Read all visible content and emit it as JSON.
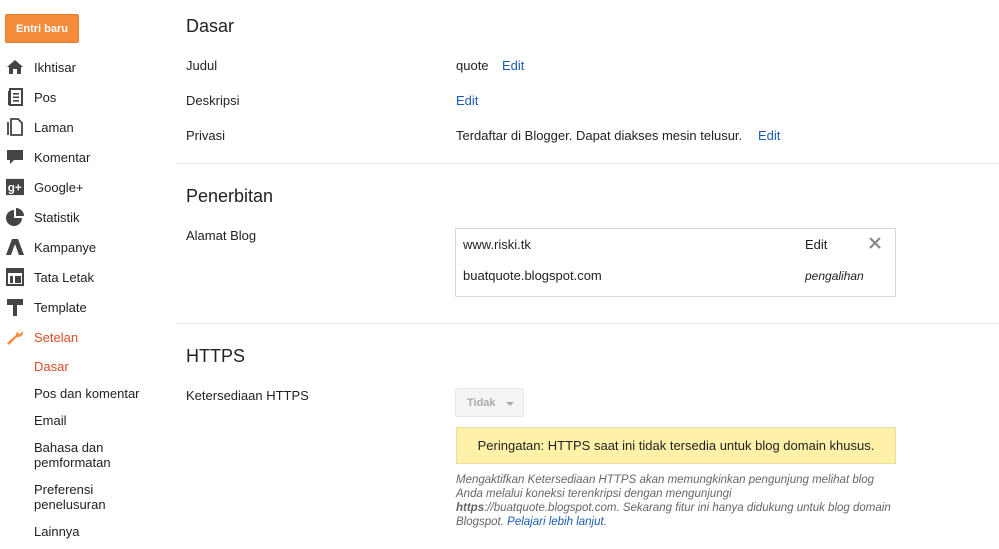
{
  "sidebar": {
    "new_post_label": "Entri baru",
    "items": [
      {
        "label": "Ikhtisar",
        "icon": "home-icon"
      },
      {
        "label": "Pos",
        "icon": "posts-icon"
      },
      {
        "label": "Laman",
        "icon": "pages-icon"
      },
      {
        "label": "Komentar",
        "icon": "comment-icon"
      },
      {
        "label": "Google+",
        "icon": "google-plus-icon"
      },
      {
        "label": "Statistik",
        "icon": "stats-icon"
      },
      {
        "label": "Kampanye",
        "icon": "adwords-icon"
      },
      {
        "label": "Tata Letak",
        "icon": "layout-icon"
      },
      {
        "label": "Template",
        "icon": "template-icon"
      },
      {
        "label": "Setelan",
        "icon": "wrench-icon",
        "active": true
      }
    ],
    "sub_items": [
      {
        "label": "Dasar",
        "active": true
      },
      {
        "label": "Pos dan komentar"
      },
      {
        "label": "Email"
      },
      {
        "label": "Bahasa dan pemformatan"
      },
      {
        "label": "Preferensi penelusuran"
      },
      {
        "label": "Lainnya"
      }
    ],
    "active_color": "#dd4b25"
  },
  "basic": {
    "title": "Dasar",
    "judul_label": "Judul",
    "judul_value": "quote",
    "deskripsi_label": "Deskripsi",
    "privasi_label": "Privasi",
    "privasi_value": "Terdaftar di Blogger. Dapat diakses mesin telusur.",
    "edit_label": "Edit"
  },
  "publishing": {
    "title": "Penerbitan",
    "address_label": "Alamat Blog",
    "custom_domain": "www.riski.tk",
    "edit_label": "Edit",
    "blogspot_domain": "buatquote.blogspot.com",
    "redirect_label": "pengalihan"
  },
  "https": {
    "title": "HTTPS",
    "availability_label": "Ketersediaan HTTPS",
    "select_value": "Tidak",
    "warning": "Peringatan: HTTPS saat ini tidak tersedia untuk blog domain khusus.",
    "help_part1": "Mengaktifkan Ketersediaan HTTPS akan memungkinkan pengunjung melihat blog Anda melalui koneksi terenkripsi dengan mengunjungi ",
    "help_bold": "https",
    "help_part2": "://buatquote.blogspot.com. Sekarang fitur ini hanya didukung untuk blog domain Blogspot. ",
    "help_link": "Pelajari lebih lanjut",
    "help_end": ".",
    "warning_bg": "#fff1a8"
  },
  "colors": {
    "accent_button": "#f48c3b",
    "link": "#1a5cb4"
  }
}
